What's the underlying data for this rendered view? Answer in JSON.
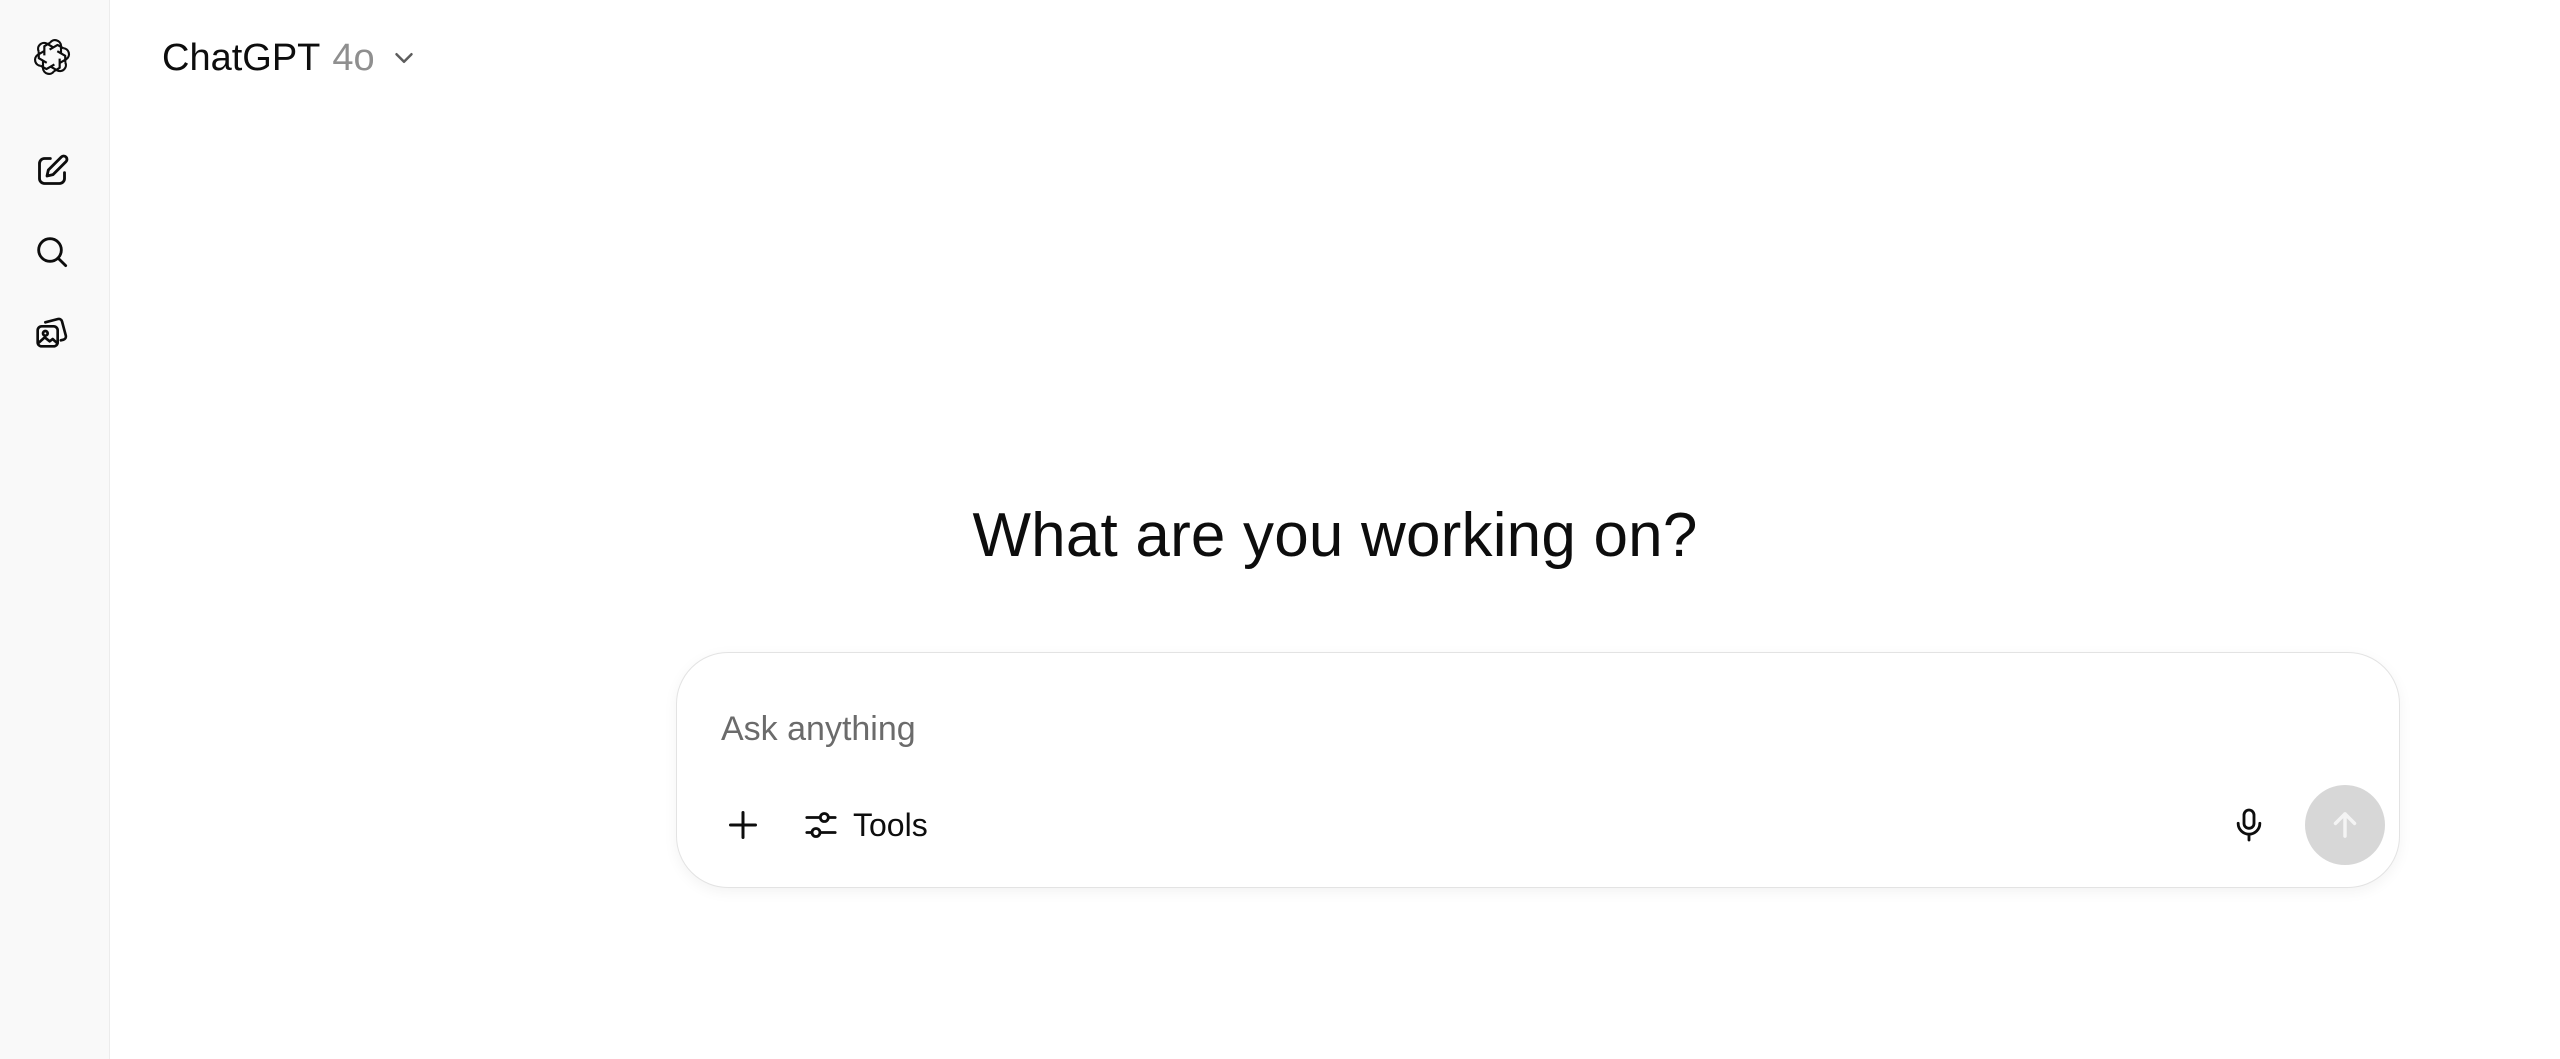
{
  "sidebar": {
    "logo_icon": "openai-logo-icon",
    "items": [
      {
        "name": "new-chat",
        "icon": "pencil-square-icon"
      },
      {
        "name": "search-chats",
        "icon": "search-icon"
      },
      {
        "name": "library",
        "icon": "image-gallery-icon"
      }
    ]
  },
  "header": {
    "model_name": "ChatGPT",
    "model_version": "4o",
    "dropdown_icon": "chevron-down-icon"
  },
  "main": {
    "headline": "What are you working on?"
  },
  "composer": {
    "placeholder": "Ask anything",
    "value": "",
    "add_icon": "plus-icon",
    "tools_label": "Tools",
    "tools_icon": "sliders-icon",
    "mic_icon": "microphone-icon",
    "send_icon": "arrow-up-icon"
  },
  "colors": {
    "background": "#ffffff",
    "sidebar_background": "#f9f9f9",
    "text": "#0d0d0d",
    "muted_text": "#8f8f8f",
    "send_button_disabled": "#d7d7d7"
  }
}
